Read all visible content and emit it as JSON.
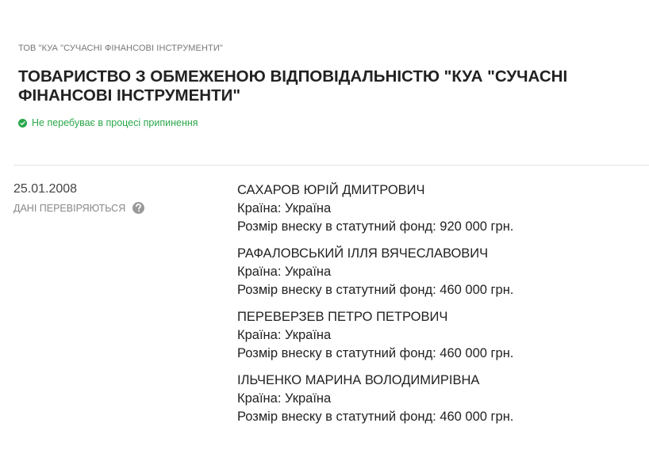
{
  "company": {
    "short_name": "ТОВ \"КУА \"СУЧАСНІ ФІНАНСОВІ ІНСТРУМЕНТИ\"",
    "full_name": "ТОВАРИСТВО З ОБМЕЖЕНОЮ ВІДПОВІДАЛЬНІСТЮ \"КУА \"СУЧАСНІ ФІНАНСОВІ ІНСТРУМЕНТИ\"",
    "status": "Не перебуває в процесі припинення",
    "status_color": "#2aa84a",
    "status_icon": "check-circle-icon"
  },
  "record": {
    "date": "25.01.2008",
    "verification_label": "ДАНІ ПЕРЕВІРЯЮТЬСЯ",
    "verification_icon": "question-circle-icon"
  },
  "founders": [
    {
      "name": "САХАРОВ ЮРІЙ ДМИТРОВИЧ",
      "country": "Країна: Україна",
      "contribution": "Розмір внеску в статутний фонд: 920 000 грн."
    },
    {
      "name": "РАФАЛОВСЬКИЙ ІЛЛЯ ВЯЧЕСЛАВОВИЧ",
      "country": "Країна: Україна",
      "contribution": "Розмір внеску в статутний фонд: 460 000 грн."
    },
    {
      "name": "ПЕРЕВЕРЗЕВ ПЕТРО ПЕТРОВИЧ",
      "country": "Країна: Україна",
      "contribution": "Розмір внеску в статутний фонд: 460 000 грн."
    },
    {
      "name": "ІЛЬЧЕНКО МАРИНА ВОЛОДИМИРІВНА",
      "country": "Країна: Україна",
      "contribution": "Розмір внеску в статутний фонд: 460 000 грн."
    }
  ]
}
